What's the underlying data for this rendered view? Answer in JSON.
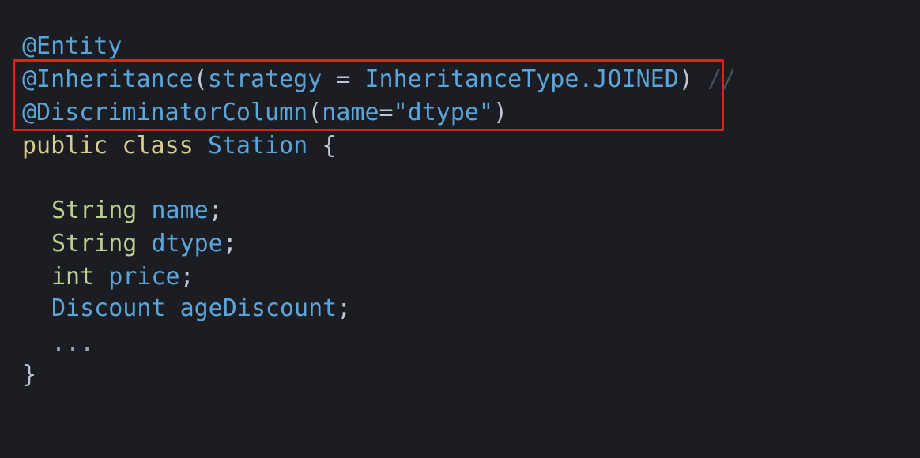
{
  "code": {
    "line1": {
      "annotation": "@Entity"
    },
    "line2": {
      "annotation": "@Inheritance",
      "open": "(",
      "param": "strategy",
      "eq": " = ",
      "value": "InheritanceType.JOINED",
      "close": ")",
      "comment": " //"
    },
    "line3": {
      "annotation": "@DiscriminatorColumn",
      "open": "(",
      "param": "name",
      "eq": "=",
      "value": "\"dtype\"",
      "close": ")"
    },
    "line4": {
      "kw_public": "public",
      "kw_class": "class",
      "class_name": "Station",
      "brace": "{"
    },
    "fields": [
      {
        "type": "String",
        "name": "name",
        "semi": ";"
      },
      {
        "type": "String",
        "name": "dtype",
        "semi": ";"
      },
      {
        "type": "int",
        "name": "price",
        "semi": ";"
      },
      {
        "type": "Discount",
        "name": "ageDiscount",
        "semi": ";"
      }
    ],
    "ellipsis": "...",
    "close_brace": "}"
  },
  "colors": {
    "background": "#1b1d23",
    "annotation": "#5aa5d9",
    "keyword": "#d4cf8a",
    "type": "#bcd08f",
    "highlight_border": "#e0201b"
  }
}
